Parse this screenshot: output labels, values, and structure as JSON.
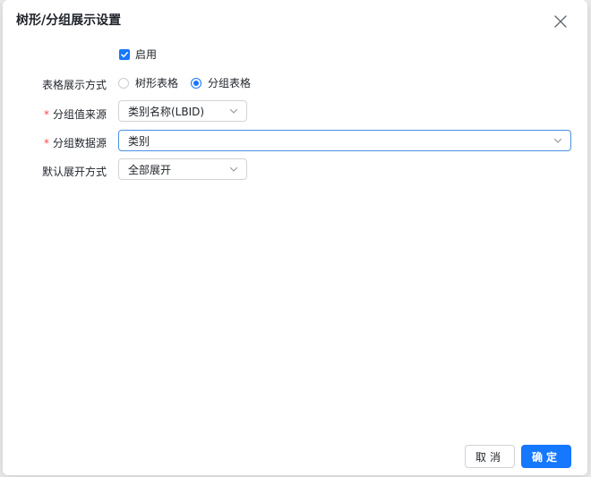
{
  "dialog": {
    "title": "树形/分组展示设置"
  },
  "enable": {
    "label": "启用",
    "checked": true
  },
  "display_mode": {
    "label": "表格展示方式",
    "options": [
      "树形表格",
      "分组表格"
    ],
    "selected": "分组表格"
  },
  "group_value_source": {
    "label": "分组值来源",
    "required": true,
    "value": "类别名称(LBID)"
  },
  "group_data_source": {
    "label": "分组数据源",
    "required": true,
    "value": "类别"
  },
  "default_expand": {
    "label": "默认展开方式",
    "value": "全部展开"
  },
  "footer": {
    "cancel_label": "取消",
    "ok_label": "确定"
  },
  "colors": {
    "primary": "#1677ff",
    "required": "#f54a45"
  }
}
